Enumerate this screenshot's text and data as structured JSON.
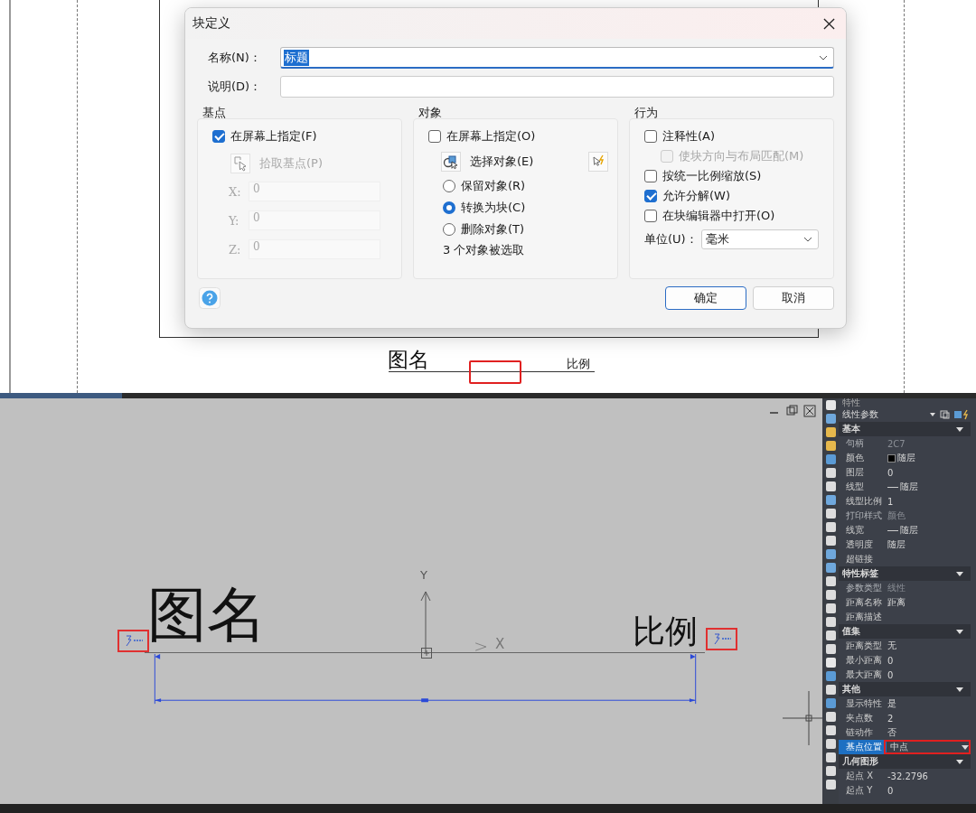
{
  "top_drawing": {
    "title_text": "图名",
    "scale_text": "比例"
  },
  "dialog": {
    "title": "块定义",
    "name": {
      "label": "名称(N)：",
      "value": "标题"
    },
    "description": {
      "label": "说明(D)："
    },
    "base_point": {
      "title": "基点",
      "on_screen": {
        "label": "在屏幕上指定(F)",
        "checked": true
      },
      "pick": {
        "label": "拾取基点(P)"
      },
      "coords": [
        {
          "label": "X:",
          "value": "0"
        },
        {
          "label": "Y:",
          "value": "0"
        },
        {
          "label": "Z:",
          "value": "0"
        }
      ]
    },
    "objects": {
      "title": "对象",
      "on_screen": {
        "label": "在屏幕上指定(O)",
        "checked": false
      },
      "select": {
        "label": "选择对象(E)"
      },
      "options": [
        {
          "label": "保留对象(R)",
          "selected": false
        },
        {
          "label": "转换为块(C)",
          "selected": true
        },
        {
          "label": "删除对象(T)",
          "selected": false
        }
      ],
      "status": "3 个对象被选取"
    },
    "behavior": {
      "title": "行为",
      "checks": [
        {
          "label": "注释性(A)",
          "checked": false,
          "disabled": false,
          "children": [
            {
              "label": "使块方向与布局匹配(M)",
              "checked": false,
              "disabled": true
            }
          ]
        },
        {
          "label": "按统一比例缩放(S)",
          "checked": false,
          "disabled": false
        },
        {
          "label": "允许分解(W)",
          "checked": true,
          "disabled": false
        },
        {
          "label": "在块编辑器中打开(O)",
          "checked": false,
          "disabled": false
        }
      ],
      "unit": {
        "label": "单位(U)：",
        "value": "毫米"
      }
    },
    "buttons": [
      {
        "label": "确定",
        "default": true
      },
      {
        "label": "取消",
        "default": false
      }
    ]
  },
  "cad": {
    "axis_y": "Y",
    "axis_x": "X",
    "title_text": "图名",
    "scale_text": "比例"
  },
  "properties": {
    "title": "特性",
    "selector": "线性参数",
    "sections": [
      {
        "title": "基本",
        "expanded": true,
        "rows": [
          {
            "label": "句柄",
            "value": "2C7",
            "kind": "text",
            "muted": true,
            "selected": false
          },
          {
            "label": "颜色",
            "value": "随层",
            "kind": "swatch",
            "muted": false,
            "selected": false
          },
          {
            "label": "图层",
            "value": "0",
            "kind": "text",
            "muted": false,
            "selected": false
          },
          {
            "label": "线型",
            "value": "随层",
            "kind": "line",
            "muted": false,
            "selected": false
          },
          {
            "label": "线型比例",
            "value": "1",
            "kind": "text",
            "muted": false,
            "selected": false
          },
          {
            "label": "打印样式",
            "value": "颜色",
            "kind": "text",
            "muted": true,
            "selected": false
          },
          {
            "label": "线宽",
            "value": "随层",
            "kind": "line",
            "muted": false,
            "selected": false
          },
          {
            "label": "透明度",
            "value": "随层",
            "kind": "text",
            "muted": false,
            "selected": false
          },
          {
            "label": "超链接",
            "kind": "text",
            "muted": false,
            "selected": false
          }
        ]
      },
      {
        "title": "特性标签",
        "expanded": true,
        "rows": [
          {
            "label": "参数类型",
            "value": "线性",
            "kind": "text",
            "muted": true,
            "selected": false
          },
          {
            "label": "距离名称",
            "value": "距离",
            "kind": "text",
            "muted": false,
            "selected": false
          },
          {
            "label": "距离描述",
            "kind": "text",
            "muted": false,
            "selected": false
          }
        ]
      },
      {
        "title": "值集",
        "expanded": true,
        "rows": [
          {
            "label": "距离类型",
            "value": "无",
            "kind": "text",
            "muted": false,
            "selected": false
          },
          {
            "label": "最小距离",
            "value": "0",
            "kind": "text",
            "muted": false,
            "selected": false
          },
          {
            "label": "最大距离",
            "value": "0",
            "kind": "text",
            "muted": false,
            "selected": false
          }
        ]
      },
      {
        "title": "其他",
        "expanded": true,
        "rows": [
          {
            "label": "显示特性",
            "value": "是",
            "kind": "text",
            "muted": false,
            "selected": false
          },
          {
            "label": "夹点数",
            "value": "2",
            "kind": "text",
            "muted": false,
            "selected": false
          },
          {
            "label": "链动作",
            "value": "否",
            "kind": "text",
            "muted": false,
            "selected": false
          },
          {
            "label": "基点位置",
            "value": "中点",
            "kind": "text",
            "muted": false,
            "selected": true
          }
        ]
      },
      {
        "title": "几何图形",
        "expanded": true,
        "rows": [
          {
            "label": "起点 X",
            "value": "-32.2796",
            "kind": "text",
            "muted": false,
            "selected": false
          },
          {
            "label": "起点 Y",
            "value": "0",
            "kind": "text",
            "muted": false,
            "selected": false
          }
        ]
      }
    ]
  }
}
